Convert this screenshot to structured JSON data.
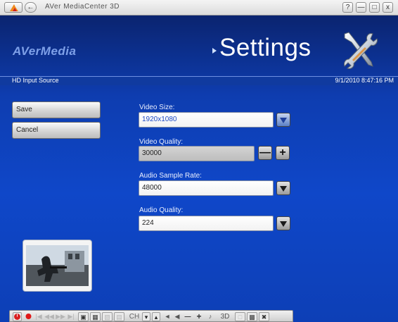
{
  "window": {
    "title": "AVer MediaCenter 3D",
    "controls": {
      "help": "?",
      "minimize": "—",
      "maximize": "□",
      "close": "x"
    }
  },
  "header": {
    "brand": "AVerMedia",
    "page_title": "Settings"
  },
  "infobar": {
    "source": "HD Input Source",
    "datetime": "9/1/2010 8:47:16 PM"
  },
  "actions": {
    "save": "Save",
    "cancel": "Cancel"
  },
  "form": {
    "video_size": {
      "label": "Video Size:",
      "value": "1920x1080"
    },
    "video_quality": {
      "label": "Video Quality:",
      "value": "30000",
      "minus": "—",
      "plus": "+"
    },
    "audio_sample_rate": {
      "label": "Audio Sample Rate:",
      "value": "48000"
    },
    "audio_quality": {
      "label": "Audio Quality:",
      "value": "224"
    }
  },
  "controlbar": {
    "channel": "CH",
    "ch_down": "▾",
    "ch_up": "▴",
    "vol_minus": "—",
    "vol_plus": "+",
    "three_d": "3D"
  },
  "colors": {
    "background": "#0f47c9",
    "infobar": "#103a9f",
    "accent_blue": "#1e4bc4"
  }
}
